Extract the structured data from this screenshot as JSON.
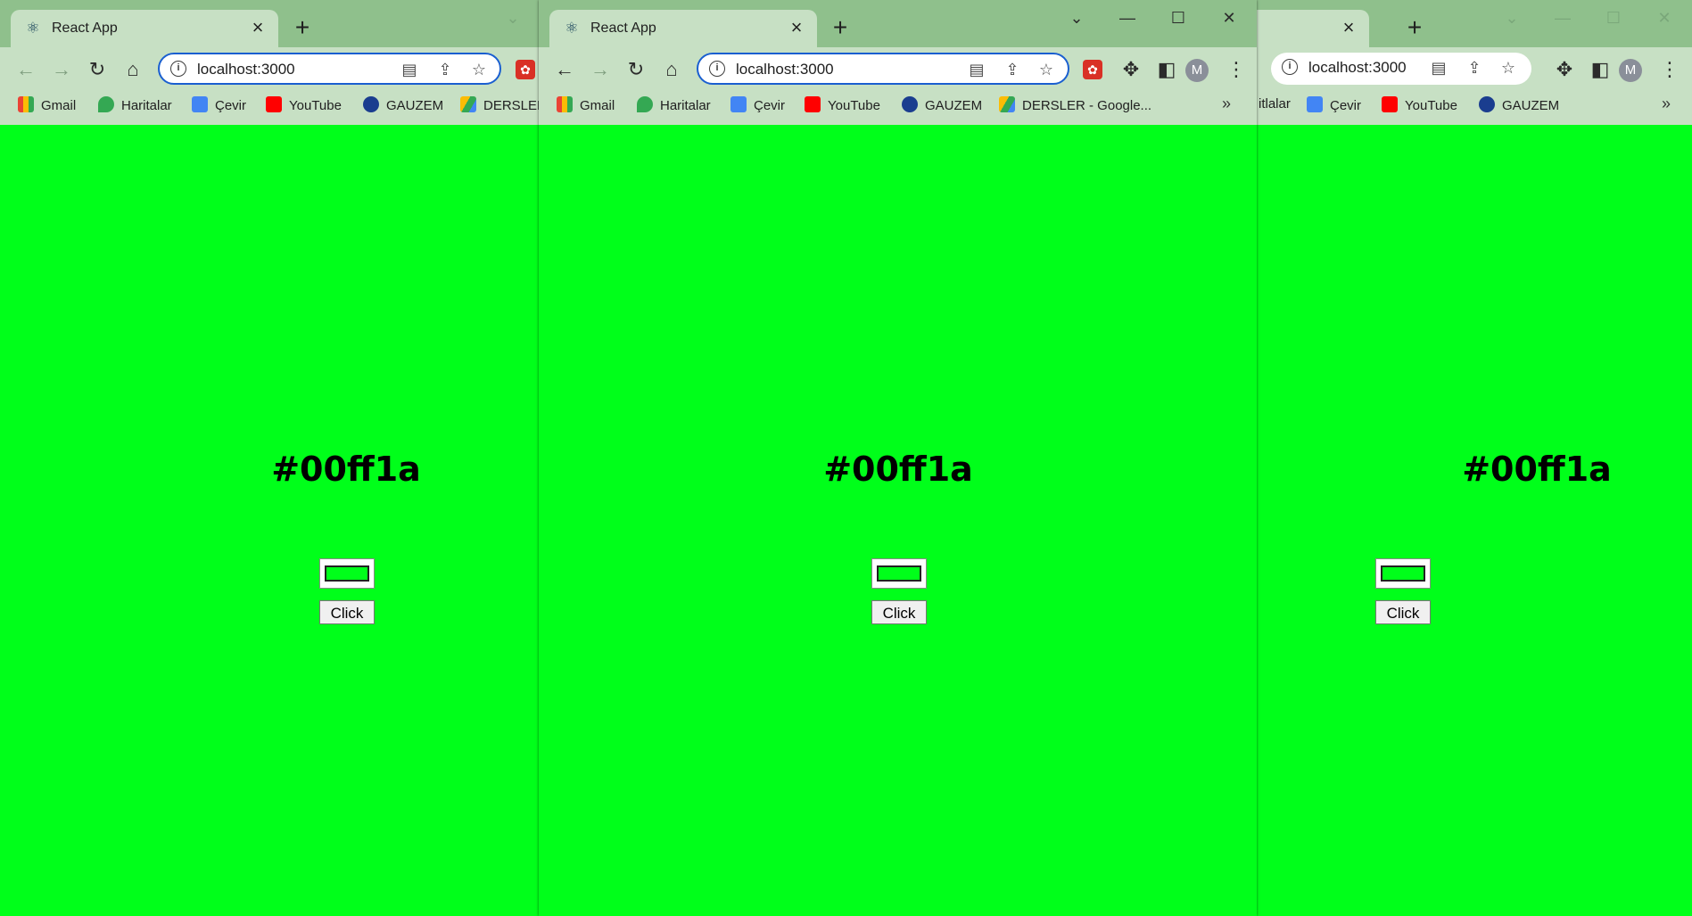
{
  "colors": {
    "page_background": "#00ff1a",
    "titlebar": "#8fc08c",
    "toolbar": "#c7e0c4"
  },
  "windows": [
    {
      "id": "left",
      "tab_title": "React App",
      "url": "localhost:3000",
      "bookmarks": [
        "Gmail",
        "Haritalar",
        "Çevir",
        "YouTube",
        "GAUZEM",
        "DERSLER"
      ],
      "hex_label": "#00ff1a",
      "button_label": "Click"
    },
    {
      "id": "middle",
      "tab_title": "React App",
      "url": "localhost:3000",
      "bookmarks": [
        "Gmail",
        "Haritalar",
        "Çevir",
        "YouTube",
        "GAUZEM",
        "DERSLER - Google..."
      ],
      "more_bookmarks": "»",
      "avatar_letter": "M",
      "hex_label": "#00ff1a",
      "button_label": "Click"
    },
    {
      "id": "right",
      "url": "localhost:3000",
      "bookmarks": [
        "itlalar",
        "Çevir",
        "YouTube",
        "GAUZEM"
      ],
      "more_bookmarks": "»",
      "avatar_letter": "M",
      "hex_label": "#00ff1a",
      "button_label": "Click"
    }
  ],
  "icons": {
    "back": "back-arrow-icon",
    "forward": "forward-arrow-icon",
    "reload": "reload-icon",
    "home": "home-icon",
    "info": "info-icon",
    "translate": "translate-icon",
    "share": "share-icon",
    "star": "star-icon",
    "extensions": "puzzle-icon",
    "sidepanel": "side-panel-icon",
    "menu": "kebab-menu-icon"
  }
}
